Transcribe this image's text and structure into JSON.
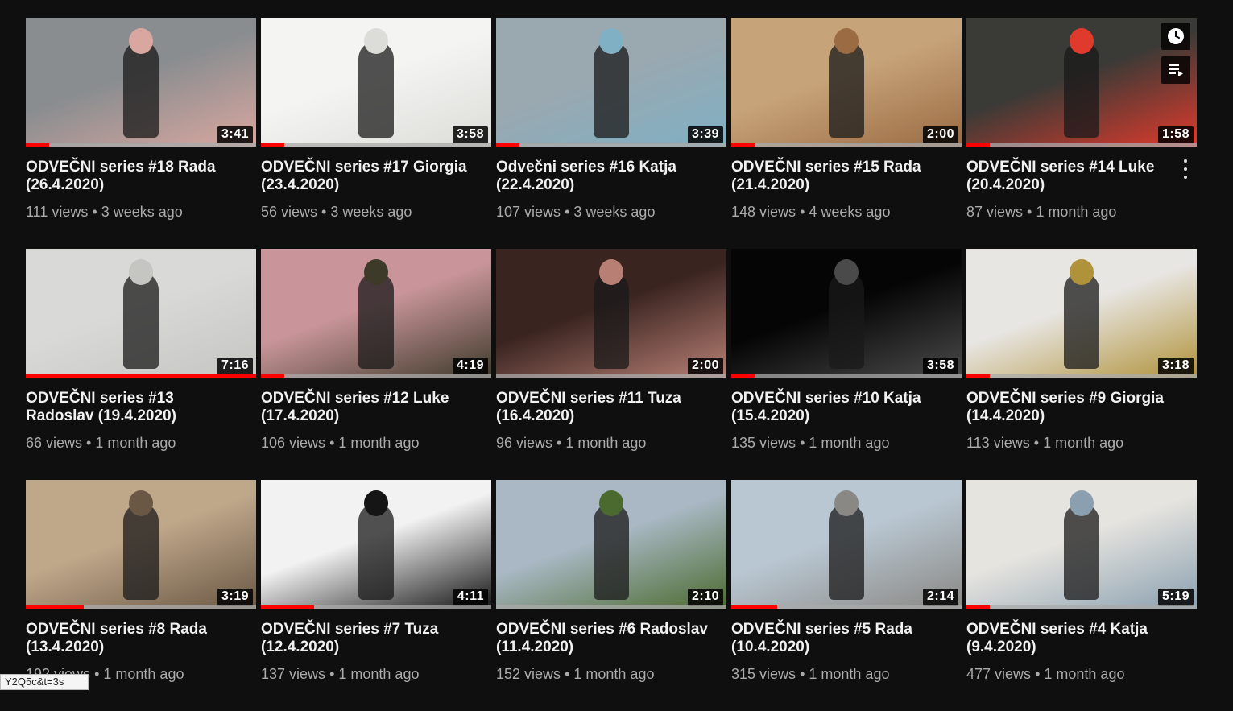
{
  "videos": [
    {
      "title": "ODVEČNI series #18 Rada (26.4.2020)",
      "views": "111 views",
      "age": "3 weeks ago",
      "duration": "3:41",
      "progress": 0.1,
      "colors": [
        "#8a8d90",
        "#d9a79f"
      ],
      "icon": "dancer-rooftop"
    },
    {
      "title": "ODVEČNI series #17 Giorgia (23.4.2020)",
      "views": "56 views",
      "age": "3 weeks ago",
      "duration": "3:58",
      "progress": 0.1,
      "colors": [
        "#f4f4f2",
        "#dcdcd8"
      ],
      "icon": "dancer-white-room"
    },
    {
      "title": "Odvečni series #16 Katja (22.4.2020)",
      "views": "107 views",
      "age": "3 weeks ago",
      "duration": "3:39",
      "progress": 0.1,
      "colors": [
        "#9aa8b0",
        "#7fb0c4"
      ],
      "icon": "person-on-sofa"
    },
    {
      "title": "ODVEČNI series #15 Rada (21.4.2020)",
      "views": "148 views",
      "age": "4 weeks ago",
      "duration": "2:00",
      "progress": 0.1,
      "colors": [
        "#c7a37a",
        "#9b6b43"
      ],
      "icon": "dancer-living-room"
    },
    {
      "title": "ODVEČNI series #14 Luke (20.4.2020)",
      "views": "87 views",
      "age": "1 month ago",
      "duration": "1:58",
      "progress": 0.1,
      "colors": [
        "#3a3a36",
        "#e03a2c"
      ],
      "icon": "man-red-shirt"
    },
    {
      "title": "ODVEČNI series #13 Radoslav (19.4.2020)",
      "views": "66 views",
      "age": "1 month ago",
      "duration": "7:16",
      "progress": 1,
      "colors": [
        "#d9d9d7",
        "#c5c5c2"
      ],
      "icon": "man-bending"
    },
    {
      "title": "ODVEČNI series #12 Luke (17.4.2020)",
      "views": "106 views",
      "age": "1 month ago",
      "duration": "4:19",
      "progress": 0.1,
      "colors": [
        "#c9959a",
        "#3e3a2a"
      ],
      "icon": "man-pink-wall"
    },
    {
      "title": "ODVEČNI series #11 Tuza (16.4.2020)",
      "views": "96 views",
      "age": "1 month ago",
      "duration": "2:00",
      "progress": 0,
      "colors": [
        "#3a2420",
        "#b88075"
      ],
      "icon": "eyes-closeup"
    },
    {
      "title": "ODVEČNI series #10 Katja (15.4.2020)",
      "views": "135 views",
      "age": "1 month ago",
      "duration": "3:58",
      "progress": 0.1,
      "colors": [
        "#050505",
        "#4a4a4a"
      ],
      "icon": "dancer-spotlight"
    },
    {
      "title": "ODVEČNI series #9 Giorgia (14.4.2020)",
      "views": "113 views",
      "age": "1 month ago",
      "duration": "3:18",
      "progress": 0.1,
      "colors": [
        "#e8e6e3",
        "#b0923a"
      ],
      "icon": "woman-selfie"
    },
    {
      "title": "ODVEČNI series #8 Rada (13.4.2020)",
      "views": "192 views",
      "age": "1 month ago",
      "duration": "3:19",
      "progress": 0.25,
      "colors": [
        "#bfa78a",
        "#6a5845"
      ],
      "icon": "woman-stairs"
    },
    {
      "title": "ODVEČNI series #7 Tuza (12.4.2020)",
      "views": "137 views",
      "age": "1 month ago",
      "duration": "4:11",
      "progress": 0.23,
      "colors": [
        "#f2f2f2",
        "#151515"
      ],
      "icon": "masked-person"
    },
    {
      "title": "ODVEČNI series #6 Radoslav (11.4.2020)",
      "views": "152 views",
      "age": "1 month ago",
      "duration": "2:10",
      "progress": 0,
      "colors": [
        "#a9b8c4",
        "#4b6a2f"
      ],
      "icon": "man-garden"
    },
    {
      "title": "ODVEČNI series #5 Rada (10.4.2020)",
      "views": "315 views",
      "age": "1 month ago",
      "duration": "2:14",
      "progress": 0.2,
      "colors": [
        "#b9c7d2",
        "#8a8884"
      ],
      "icon": "dancer-rooftop-city"
    },
    {
      "title": "ODVEČNI series #4 Katja (9.4.2020)",
      "views": "477 views",
      "age": "1 month ago",
      "duration": "5:19",
      "progress": 0.1,
      "colors": [
        "#e6e4df",
        "#8aa0b0"
      ],
      "icon": "dancer-apartment"
    }
  ],
  "hover": {
    "watch_later_icon": "clock-icon",
    "add_to_queue_icon": "queue-icon",
    "menu_icon": "more-vert-icon"
  },
  "status_url": "Y2Q5c&t=3s",
  "separator": "•"
}
